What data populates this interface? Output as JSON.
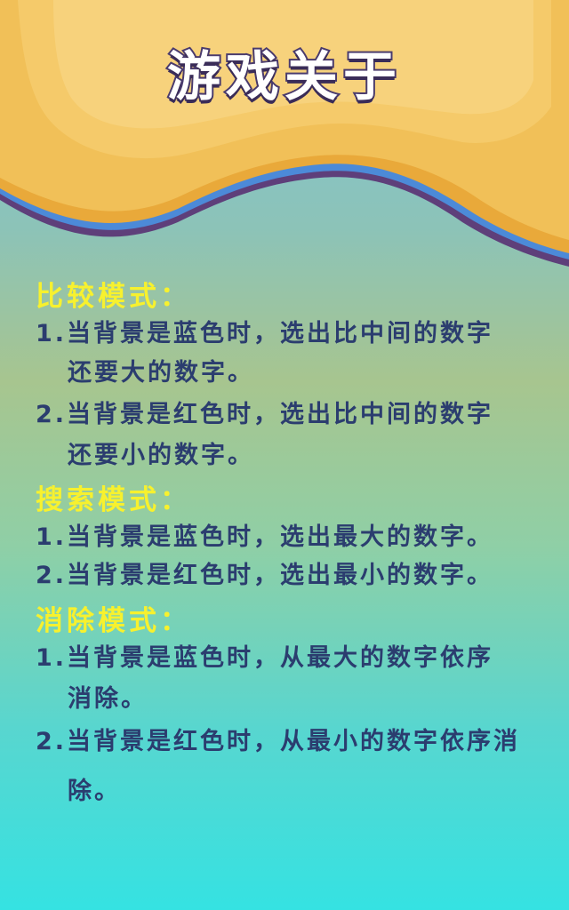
{
  "header": {
    "title": "游戏关于"
  },
  "colors": {
    "section_title": "#f7f12e",
    "body_text": "#2b3d6f",
    "header_bg": "#f1c058",
    "title_outline": "#4a3b6d"
  },
  "sections": [
    {
      "title": "比较模式：",
      "lines": [
        "1.当背景是蓝色时，选出比中间的数字",
        "还要大的数字。",
        "2.当背景是红色时，选出比中间的数字",
        "还要小的数字。"
      ]
    },
    {
      "title": "搜索模式：",
      "lines": [
        "1.当背景是蓝色时，选出最大的数字。",
        "2.当背景是红色时，选出最小的数字。"
      ]
    },
    {
      "title": "消除模式：",
      "lines": [
        "1.当背景是蓝色时，从最大的数字依序",
        "消除。",
        "2.当背景是红色时，从最小的数字依序消",
        "除。"
      ]
    }
  ]
}
